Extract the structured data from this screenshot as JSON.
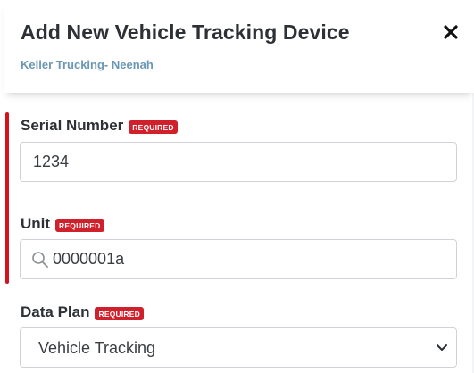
{
  "header": {
    "title": "Add New Vehicle Tracking Device",
    "subtitle": "Keller Trucking- Neenah",
    "close_label": "✕"
  },
  "form": {
    "required_badge": "REQUIRED",
    "serial_number": {
      "label": "Serial Number",
      "value": "1234"
    },
    "unit": {
      "label": "Unit",
      "value": "0000001a",
      "icon": "search-icon"
    },
    "data_plan": {
      "label": "Data Plan",
      "selected": "Vehicle Tracking",
      "icon": "chevron-down-icon"
    }
  },
  "colors": {
    "required_badge": "#d0202b",
    "focus_bar": "#d8101e",
    "subtitle": "#6a97b4",
    "title": "#2d3035"
  }
}
